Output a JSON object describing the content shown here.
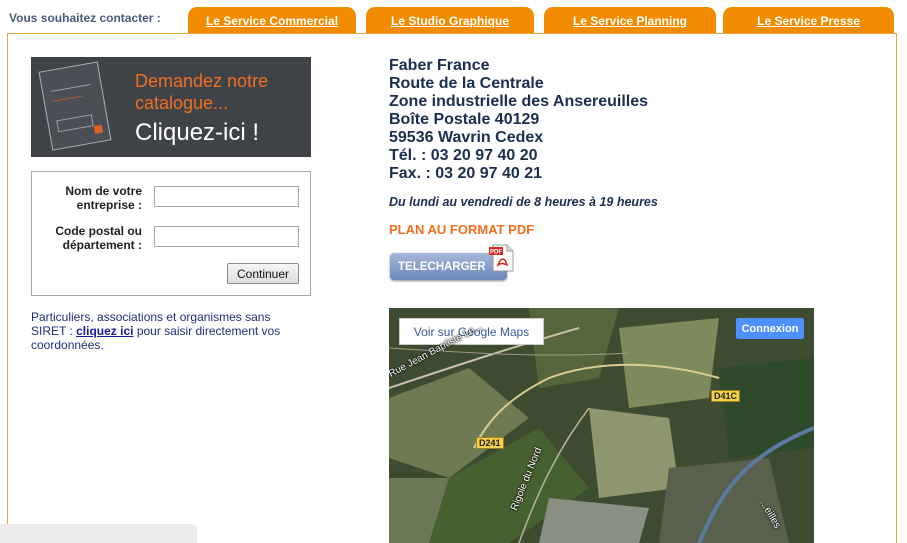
{
  "header": {
    "contact_prompt": "Vous souhaitez contacter :"
  },
  "tabs": [
    {
      "label": "Le Service Commercial"
    },
    {
      "label": "Le Studio Graphique"
    },
    {
      "label": "Le Service Planning"
    },
    {
      "label": "Le Service Presse"
    }
  ],
  "catalog": {
    "line1": "Demandez notre catalogue...",
    "line2": "Cliquez-ici !"
  },
  "form": {
    "company_label": "Nom de votre entreprise :",
    "company_value": "",
    "postal_label": "Code postal ou département :",
    "postal_value": "",
    "continue_label": "Continuer"
  },
  "individuals": {
    "text_before": "Particuliers, associations et organismes sans SIRET : ",
    "link": "cliquez ici",
    "text_after": " pour saisir directement vos coordonnées."
  },
  "address": {
    "lines": [
      "Faber France",
      "Route de la Centrale",
      "Zone industrielle des Ansereuilles",
      "Boîte Postale 40129",
      "59536 Wavrin Cedex",
      "Tél. : 03 20 97 40 20",
      "Fax. : 03 20 97 40 21"
    ]
  },
  "hours": "Du lundi au vendredi de 8 heures à 19 heures",
  "plan": {
    "title": "PLAN AU FORMAT PDF",
    "download_label": "TELECHARGER",
    "pdf_badge": "PDF"
  },
  "map": {
    "google_label": "Voir sur Google Maps",
    "login_label": "Connexion",
    "roads": {
      "d41c": "D41C",
      "d241": "D241"
    },
    "streets": {
      "street1": "Rue Jean Baptiste Le...",
      "street2": "Rigole du Nord",
      "street3": "...eilles"
    }
  },
  "colors": {
    "accent": "#f18c00",
    "navy": "#1c2e50",
    "orange_text": "#f07020"
  }
}
